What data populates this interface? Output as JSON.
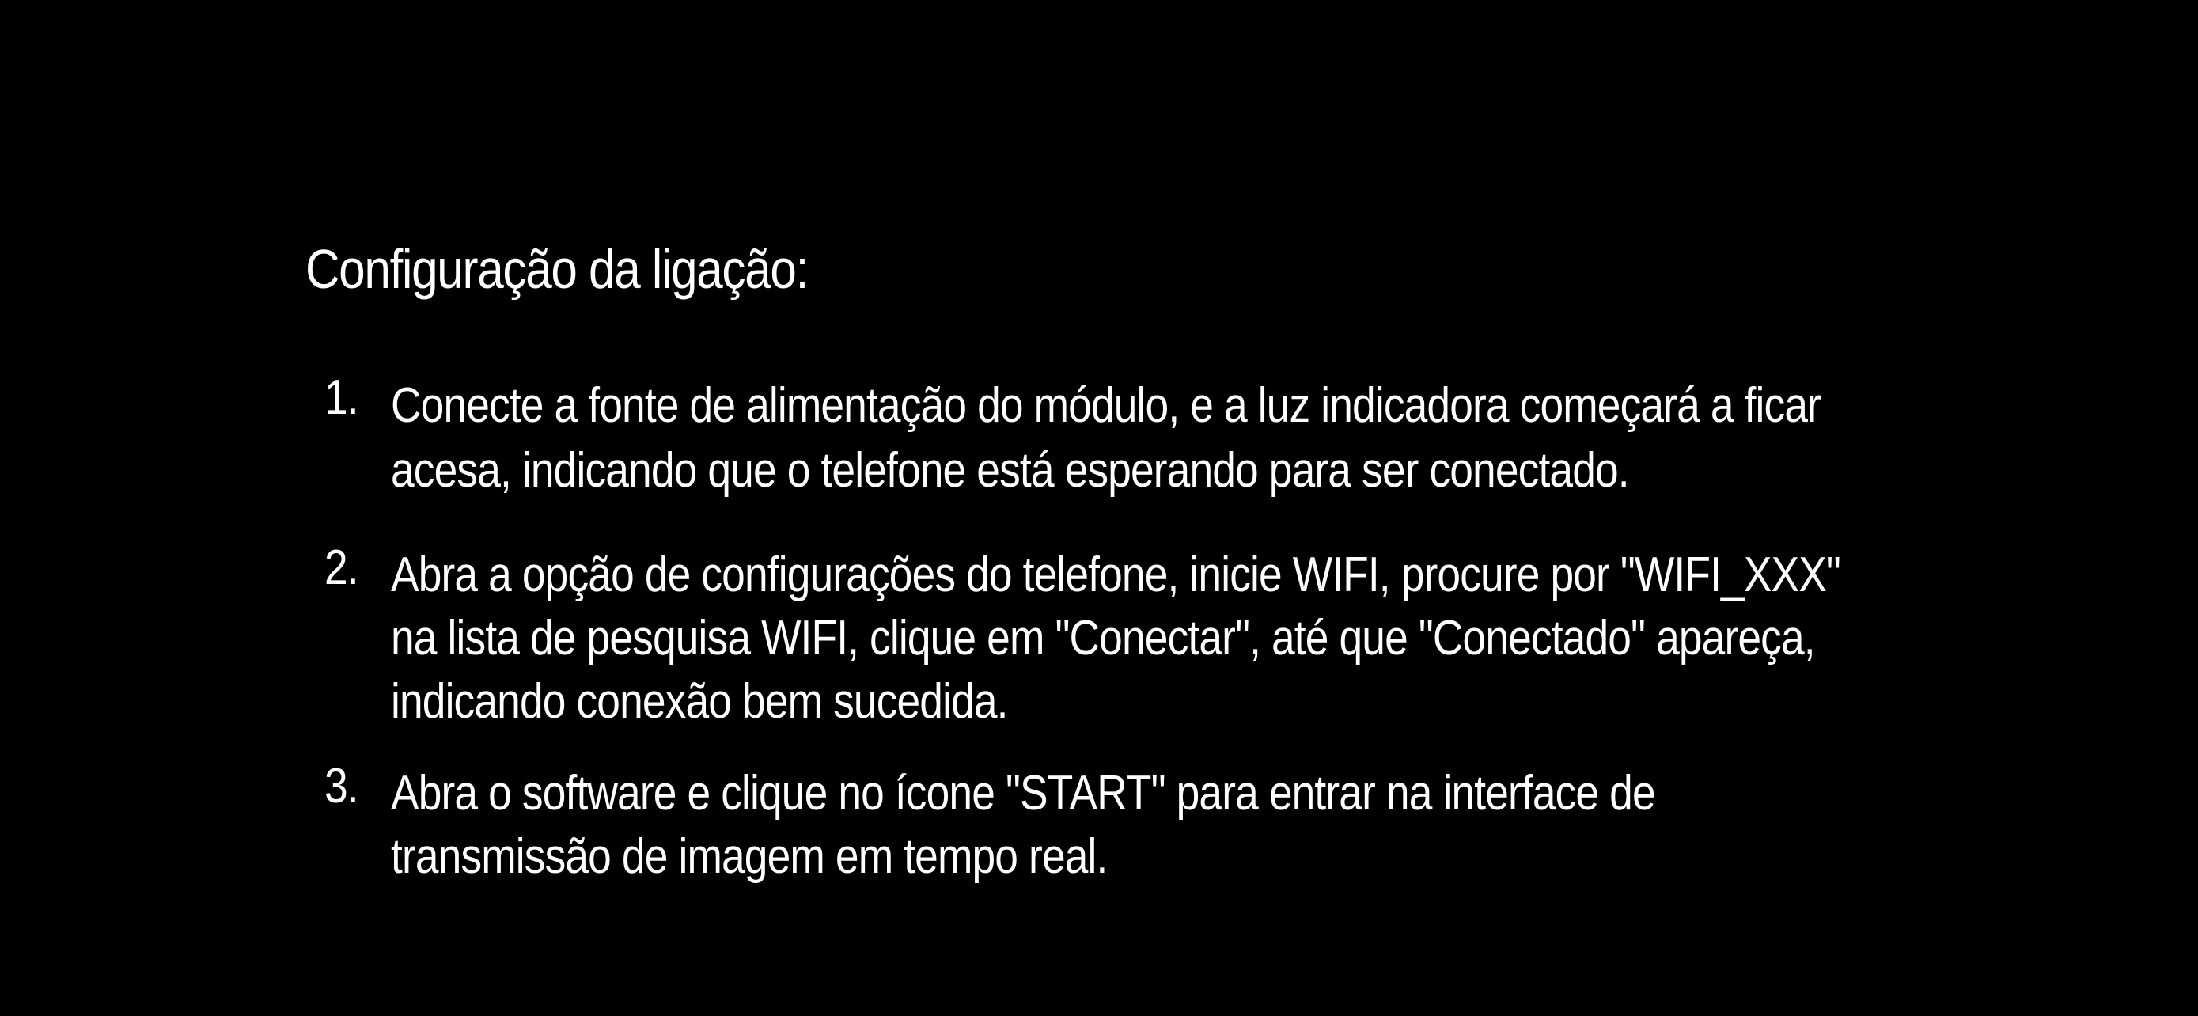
{
  "title": "Configuração da ligação:",
  "steps": [
    {
      "number": "1.",
      "text": "Conecte a fonte de alimentação do módulo, e a luz indicadora começará a ficar\nacesa, indicando que o telefone está esperando para ser conectado."
    },
    {
      "number": "2.",
      "text": "Abra a opção de configurações do telefone, inicie WIFI, procure por \"WIFI_XXX\"\nna lista de pesquisa WIFI, clique em \"Conectar\", até que \"Conectado\" apareça,\nindicando conexão bem sucedida."
    },
    {
      "number": "3.",
      "text": "Abra o software e clique no ícone \"START\" para entrar na interface de\ntransmissão de imagem em tempo real."
    }
  ]
}
